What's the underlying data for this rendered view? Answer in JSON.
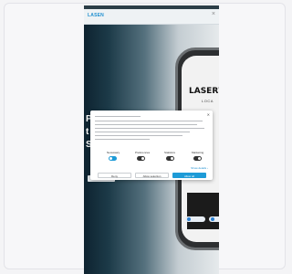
{
  "app": {
    "brand_small": "LASEN",
    "close_glyph": "×"
  },
  "hero": {
    "letters": [
      "P",
      "t",
      "S"
    ]
  },
  "device": {
    "brand": "LASERW",
    "sub": "LOCA"
  },
  "left_chip": {
    "label": "• • •"
  },
  "cookie_modal": {
    "close_glyph": "✕",
    "toggles": [
      {
        "label": "Necessary",
        "on": true
      },
      {
        "label": "Preferences",
        "on": false
      },
      {
        "label": "Statistics",
        "on": false
      },
      {
        "label": "Marketing",
        "on": false
      }
    ],
    "details_link": "Show details ›",
    "buttons": {
      "deny": "Deny",
      "allow_selection": "Allow selection",
      "allow_all": "Allow all"
    }
  },
  "colors": {
    "accent": "#1e9bd7",
    "dark": "#0e2330"
  }
}
